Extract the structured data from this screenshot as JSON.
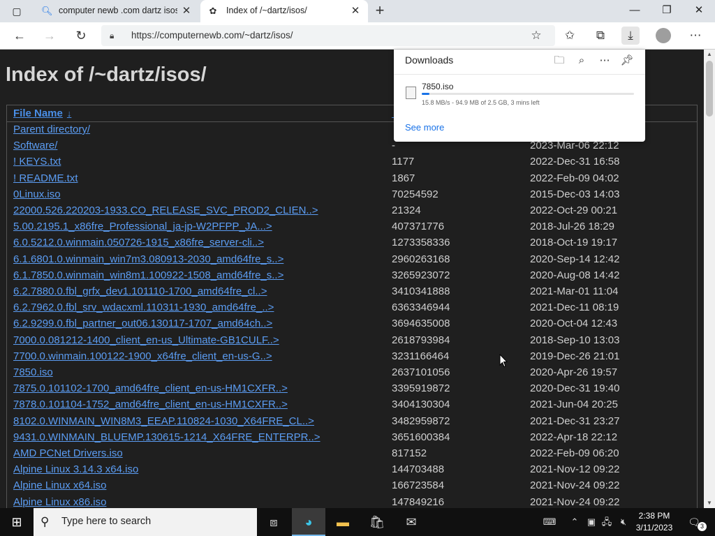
{
  "browser": {
    "tabs": [
      {
        "title": "computer newb .com dartz isos",
        "icon": "edge-search-icon"
      },
      {
        "title": "Index of /~dartz/isos/",
        "icon": "page-favicon"
      }
    ],
    "url": "https://computernewb.com/~dartz/isos/"
  },
  "page": {
    "title": "Index of /~dartz/isos/",
    "columns": {
      "name": "File Name",
      "sort_indicator": "↓"
    },
    "rows": [
      {
        "name": "Parent directory/",
        "size": "",
        "date": ""
      },
      {
        "name": "Software/",
        "size": "-",
        "date": "2023-Mar-06 22:12"
      },
      {
        "name": "! KEYS.txt",
        "size": "1177",
        "date": "2022-Dec-31 16:58"
      },
      {
        "name": "! README.txt",
        "size": "1867",
        "date": "2022-Feb-09 04:02"
      },
      {
        "name": "0Linux.iso",
        "size": "70254592",
        "date": "2015-Dec-03 14:03"
      },
      {
        "name": "22000.526.220203-1933.CO_RELEASE_SVC_PROD2_CLIEN..>",
        "size": "21324",
        "date": "2022-Oct-29 00:21"
      },
      {
        "name": "5.00.2195.1_x86fre_Professional_ja-jp-W2PFPP_JA...>",
        "size": "407371776",
        "date": "2018-Jul-26 18:29"
      },
      {
        "name": "6.0.5212.0.winmain.050726-1915_x86fre_server-cli..>",
        "size": "1273358336",
        "date": "2018-Oct-19 19:17"
      },
      {
        "name": "6.1.6801.0.winmain_win7m3.080913-2030_amd64fre_s..>",
        "size": "2960263168",
        "date": "2020-Sep-14 12:42"
      },
      {
        "name": "6.1.7850.0.winmain_win8m1.100922-1508_amd64fre_s..>",
        "size": "3265923072",
        "date": "2020-Aug-08 14:42"
      },
      {
        "name": "6.2.7880.0.fbl_grfx_dev1.101110-1700_amd64fre_cl..>",
        "size": "3410341888",
        "date": "2021-Mar-01 11:04"
      },
      {
        "name": "6.2.7962.0.fbl_srv_wdacxml.110311-1930_amd64fre_..>",
        "size": "6363346944",
        "date": "2021-Dec-11 08:19"
      },
      {
        "name": "6.2.9299.0.fbl_partner_out06.130117-1707_amd64ch..>",
        "size": "3694635008",
        "date": "2020-Oct-04 12:43"
      },
      {
        "name": "7000.0.081212-1400_client_en-us_Ultimate-GB1CULF..>",
        "size": "2618793984",
        "date": "2018-Sep-10 13:03"
      },
      {
        "name": "7700.0.winmain.100122-1900_x64fre_client_en-us-G..>",
        "size": "3231166464",
        "date": "2019-Dec-26 21:01"
      },
      {
        "name": "7850.iso",
        "size": "2637101056",
        "date": "2020-Apr-26 19:57"
      },
      {
        "name": "7875.0.101102-1700_amd64fre_client_en-us-HM1CXFR..>",
        "size": "3395919872",
        "date": "2020-Dec-31 19:40"
      },
      {
        "name": "7878.0.101104-1752_amd64fre_client_en-us-HM1CXFR..>",
        "size": "3404130304",
        "date": "2021-Jun-04 20:25"
      },
      {
        "name": "8102.0.WINMAIN_WIN8M3_EEAP.110824-1030_X64FRE_CL..>",
        "size": "3482959872",
        "date": "2021-Dec-31 23:27"
      },
      {
        "name": "9431.0.WINMAIN_BLUEMP.130615-1214_X64FRE_ENTERPR..>",
        "size": "3651600384",
        "date": "2022-Apr-18 22:12"
      },
      {
        "name": "AMD PCNet Drivers.iso",
        "size": "817152",
        "date": "2022-Feb-09 06:20"
      },
      {
        "name": "Alpine Linux 3.14.3 x64.iso",
        "size": "144703488",
        "date": "2021-Nov-12 09:22"
      },
      {
        "name": "Alpine Linux x64.iso",
        "size": "166723584",
        "date": "2021-Nov-24 09:22"
      },
      {
        "name": "Alpine Linux x86.iso",
        "size": "147849216",
        "date": "2021-Nov-24 09:22"
      }
    ]
  },
  "downloads": {
    "title": "Downloads",
    "file": "7850.iso",
    "status": "15.8 MB/s - 94.9 MB of 2.5 GB, 3 mins left",
    "progress": 0.037,
    "see_more": "See more"
  },
  "taskbar": {
    "search_placeholder": "Type here to search",
    "time": "2:38 PM",
    "date": "3/11/2023",
    "notification_count": "3"
  },
  "colors": {
    "link": "#5b9cf2",
    "background": "#1f1f1f",
    "accent": "#1a73e8"
  }
}
